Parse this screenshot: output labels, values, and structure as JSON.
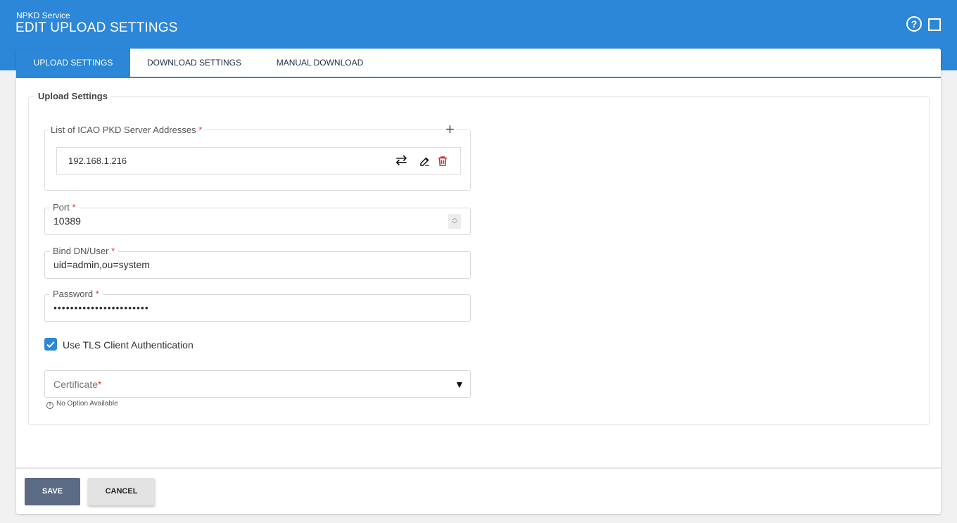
{
  "header": {
    "service_name": "NPKD Service",
    "title": "EDIT UPLOAD SETTINGS",
    "help_icon": "help-circle-icon",
    "maximize_icon": "maximize-square-icon"
  },
  "tabs": [
    {
      "label": "UPLOAD SETTINGS",
      "active": true
    },
    {
      "label": "DOWNLOAD SETTINGS",
      "active": false
    },
    {
      "label": "MANUAL DOWNLOAD",
      "active": false
    }
  ],
  "upload_settings": {
    "section_title": "Upload Settings",
    "server_list": {
      "label": "List of ICAO PKD Server Addresses",
      "required_mark": "*",
      "add_icon": "plus-icon",
      "items": [
        {
          "address": "192.168.1.216",
          "icons": [
            "swap-arrows-icon",
            "edit-icon",
            "trash-icon"
          ]
        }
      ]
    },
    "port": {
      "label": "Port",
      "required_mark": "*",
      "value": "10389"
    },
    "bind_dn": {
      "label": "Bind DN/User",
      "required_mark": "*",
      "value": "uid=admin,ou=system"
    },
    "password": {
      "label": "Password",
      "required_mark": "*",
      "value": "•••••••••••••••••••••••"
    },
    "tls": {
      "label": "Use TLS Client Authentication",
      "checked": true
    },
    "certificate": {
      "placeholder": "Certificate",
      "required_mark": "*",
      "hint": "No Option Available"
    }
  },
  "footer": {
    "save_label": "SAVE",
    "cancel_label": "CANCEL"
  },
  "colors": {
    "brand": "#2c87d8",
    "save_button": "#5b6b86",
    "required": "#e53935",
    "delete_icon": "#c62828"
  }
}
